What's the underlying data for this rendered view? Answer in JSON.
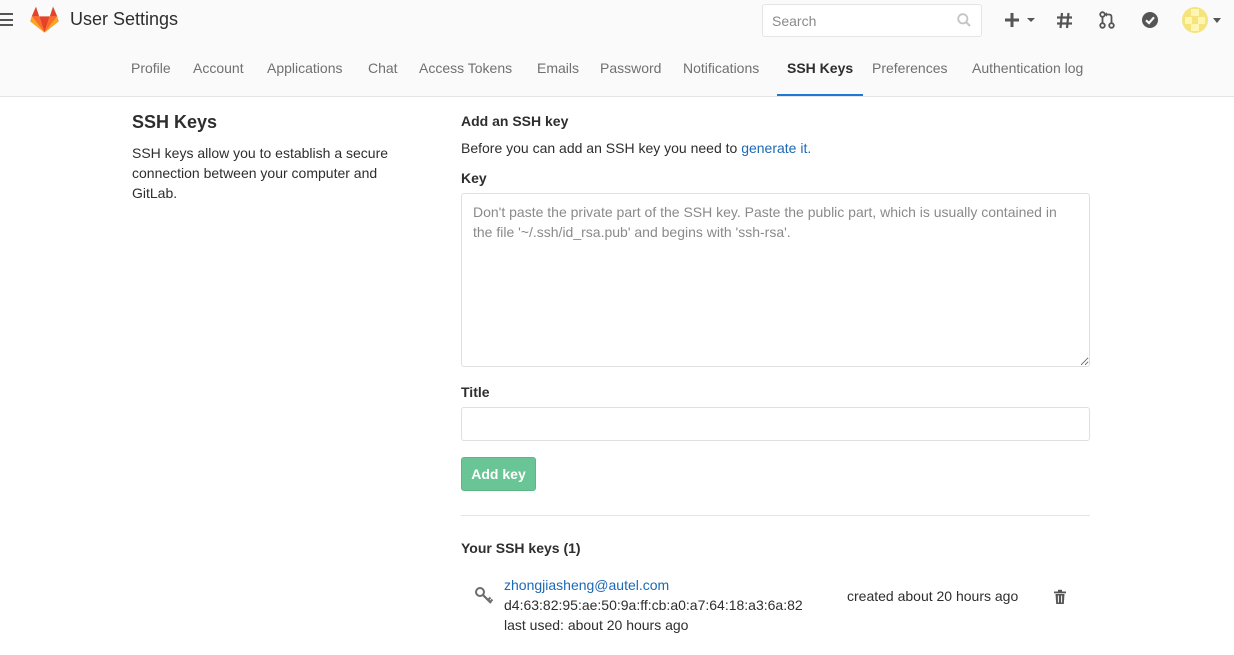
{
  "header": {
    "title": "User Settings",
    "search_placeholder": "Search",
    "icons": [
      "menu-icon",
      "gitlab-logo",
      "search-icon",
      "plus-icon",
      "chevron-down-icon",
      "hash-icon",
      "merge-request-icon",
      "todo-check-icon",
      "avatar"
    ]
  },
  "nav": {
    "tabs": [
      {
        "label": "Profile"
      },
      {
        "label": "Account"
      },
      {
        "label": "Applications"
      },
      {
        "label": "Chat"
      },
      {
        "label": "Access Tokens"
      },
      {
        "label": "Emails"
      },
      {
        "label": "Password"
      },
      {
        "label": "Notifications"
      },
      {
        "label": "SSH Keys",
        "active": true
      },
      {
        "label": "Preferences"
      },
      {
        "label": "Authentication log"
      }
    ]
  },
  "sidebar": {
    "title": "SSH Keys",
    "description": "SSH keys allow you to establish a secure connection between your computer and GitLab."
  },
  "form": {
    "heading": "Add an SSH key",
    "help_text": "Before you can add an SSH key you need to ",
    "help_link": "generate it.",
    "key_label": "Key",
    "key_placeholder": "Don't paste the private part of the SSH key. Paste the public part, which is usually contained in the file '~/.ssh/id_rsa.pub' and begins with 'ssh-rsa'.",
    "title_label": "Title",
    "title_value": "",
    "submit_label": "Add key"
  },
  "keys": {
    "heading": "Your SSH keys (1)",
    "items": [
      {
        "title": "zhongjiasheng@autel.com",
        "fingerprint": "d4:63:82:95:ae:50:9a:ff:cb:a0:a7:64:18:a3:6a:82",
        "last_used": "last used: about 20 hours ago",
        "created": "created about 20 hours ago"
      }
    ]
  },
  "colors": {
    "accent": "#1f78d1",
    "link": "#1b69b6",
    "success_button": "#69c595",
    "logo_orange": "#fc6d26",
    "logo_red": "#e24329",
    "logo_light": "#fca326"
  }
}
